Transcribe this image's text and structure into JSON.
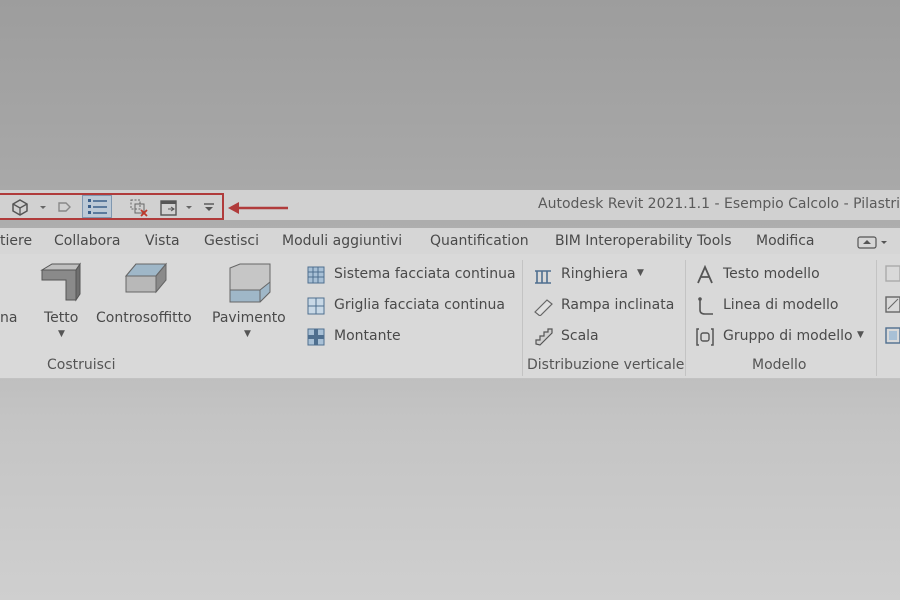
{
  "window": {
    "title": "Autodesk Revit 2021.1.1 - Esempio Calcolo - Pilastri"
  },
  "quick_access_toolbar": {
    "icons": [
      "3d-view-icon",
      "dropdown-arrow-icon",
      "tag-icon",
      "thin-lines-icon",
      "close-hidden-windows-icon",
      "switch-windows-icon",
      "dropdown-arrow-icon",
      "customize-toolbar-icon"
    ],
    "highlight_color": "#b03b3b"
  },
  "tabs": [
    {
      "label": "tiere"
    },
    {
      "label": "Collabora"
    },
    {
      "label": "Vista"
    },
    {
      "label": "Gestisci"
    },
    {
      "label": "Moduli aggiuntivi"
    },
    {
      "label": "Quantification"
    },
    {
      "label": "BIM Interoperability Tools"
    },
    {
      "label": "Modifica"
    }
  ],
  "ribbon": {
    "build_panel": {
      "title": "Costruisci",
      "partial_label": "na",
      "buttons": [
        {
          "label": "Tetto",
          "icon": "roof-icon"
        },
        {
          "label": "Controsoffitto",
          "icon": "ceiling-icon"
        },
        {
          "label": "Pavimento",
          "icon": "floor-icon"
        }
      ],
      "small_buttons": [
        {
          "label": "Sistema facciata continua",
          "icon": "curtain-system-icon"
        },
        {
          "label": "Griglia facciata continua",
          "icon": "curtain-grid-icon"
        },
        {
          "label": "Montante",
          "icon": "mullion-icon"
        }
      ]
    },
    "circulation_panel": {
      "title": "Distribuzione verticale",
      "small_buttons": [
        {
          "label": "Ringhiera",
          "icon": "railing-icon"
        },
        {
          "label": "Rampa inclinata",
          "icon": "ramp-icon"
        },
        {
          "label": "Scala",
          "icon": "stair-icon"
        }
      ]
    },
    "model_panel": {
      "title": "Modello",
      "small_buttons": [
        {
          "label": "Testo modello",
          "icon": "model-text-icon"
        },
        {
          "label": "Linea di modello",
          "icon": "model-line-icon"
        },
        {
          "label": "Gruppo di modello",
          "icon": "model-group-icon"
        }
      ]
    }
  }
}
